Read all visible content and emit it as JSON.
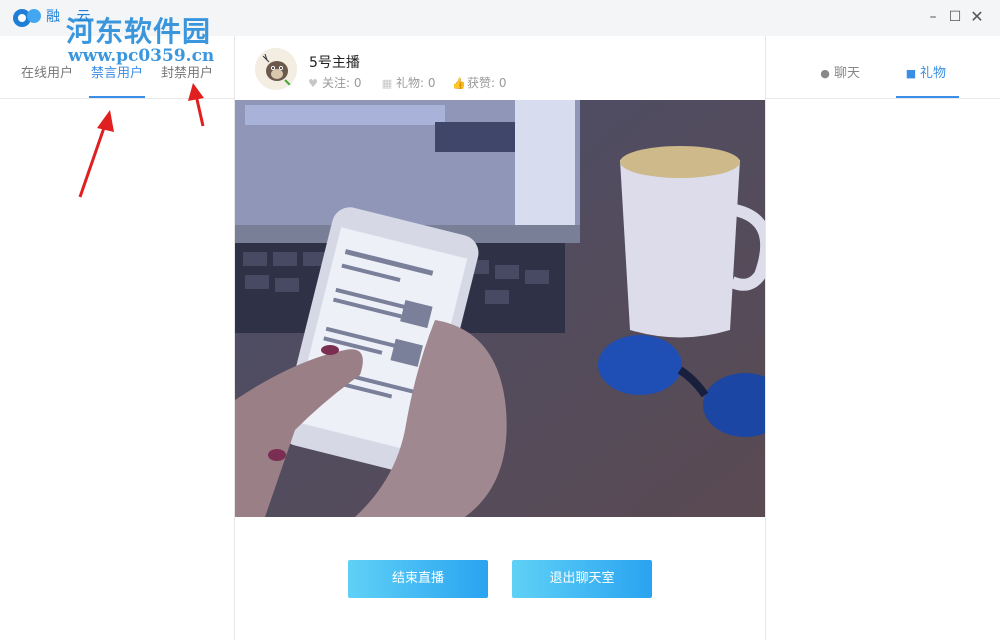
{
  "app": {
    "logo_text": "融 云"
  },
  "watermark": {
    "title": "河东软件园",
    "url": "www.pc0359.cn"
  },
  "window_controls": {
    "minimize": "–",
    "maximize": "☐",
    "close": "✕"
  },
  "left_tabs": [
    {
      "label": "在线用户",
      "active": false
    },
    {
      "label": "禁言用户",
      "active": true
    },
    {
      "label": "封禁用户",
      "active": false
    }
  ],
  "host": {
    "name": "5号主播",
    "stats": [
      {
        "icon": "heart-icon",
        "label": "关注: 0"
      },
      {
        "icon": "gift-icon",
        "label": "礼物: 0"
      },
      {
        "icon": "thumbs-up-icon",
        "label": "获赞: 0"
      }
    ]
  },
  "actions": {
    "end_live": "结束直播",
    "exit_room": "退出聊天室"
  },
  "right_tabs": [
    {
      "label": "聊天",
      "icon": "chat-bubble-icon",
      "active": false
    },
    {
      "label": "礼物",
      "icon": "gift-icon",
      "active": true
    }
  ],
  "colors": {
    "accent": "#3a8ee6",
    "button_gradient_start": "#5fd1f6",
    "button_gradient_end": "#2aa3f1",
    "annotation_arrow": "#e02020"
  }
}
